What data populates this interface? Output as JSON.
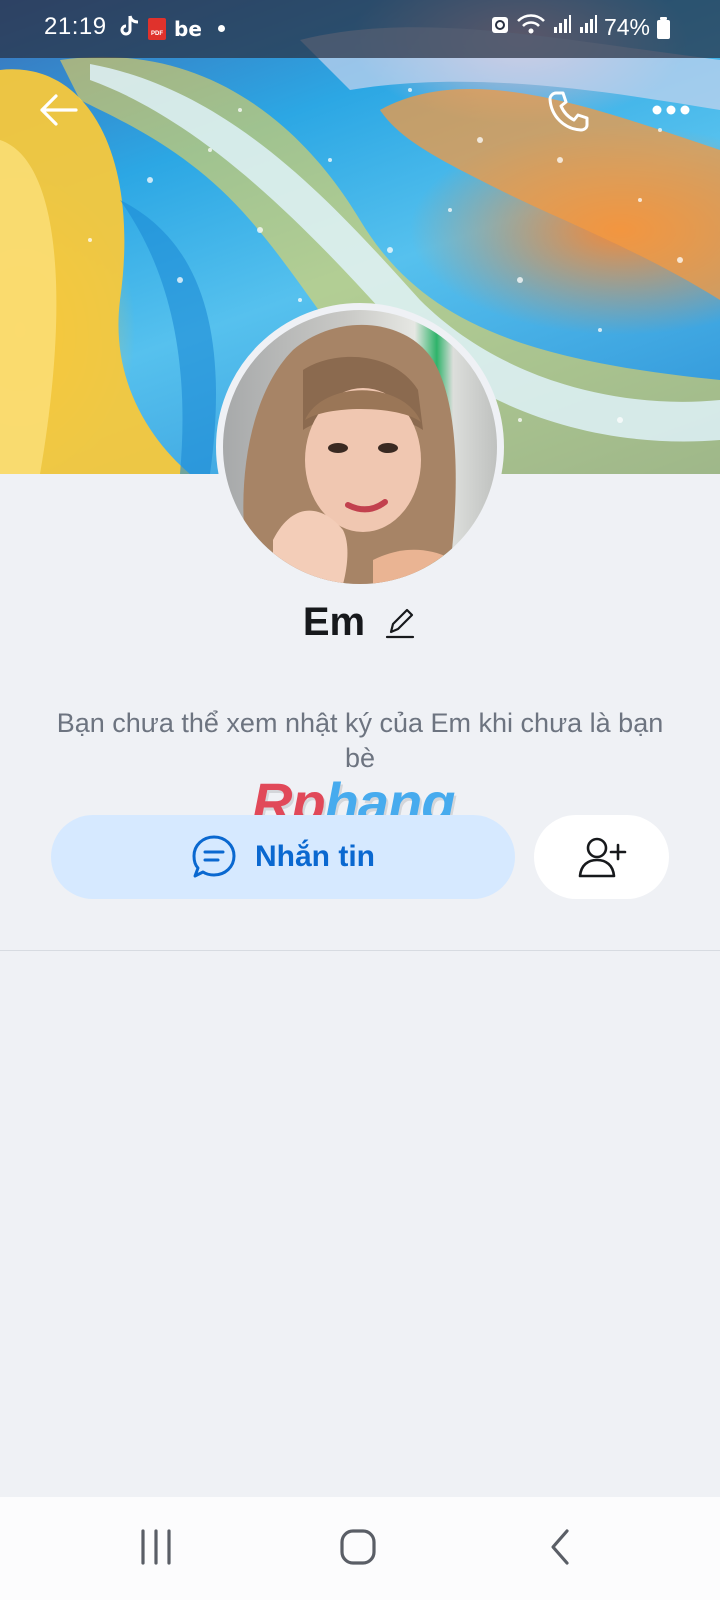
{
  "status_bar": {
    "time": "21:19",
    "notification_icons": [
      "tiktok-icon",
      "pdf-icon",
      "be-icon"
    ],
    "pdf_badge": "PDF",
    "be_badge": "be",
    "battery_percent": "74%"
  },
  "header": {
    "back_icon": "arrow-left-icon",
    "call_icon": "phone-icon",
    "more_icon": "more-horizontal-icon"
  },
  "profile": {
    "name": "Em",
    "notice": "Bạn chưa thể xem nhật ký của Em khi chưa là bạn bè"
  },
  "watermark": {
    "part_a": "Rp",
    "part_b": "hang"
  },
  "actions": {
    "message_label": "Nhắn tin",
    "message_icon": "chat-bubble-icon",
    "add_friend_icon": "user-plus-icon"
  },
  "colors": {
    "accent": "#0a68d0",
    "message_button_bg": "#d6e9ff",
    "page_bg": "#eff1f5"
  }
}
